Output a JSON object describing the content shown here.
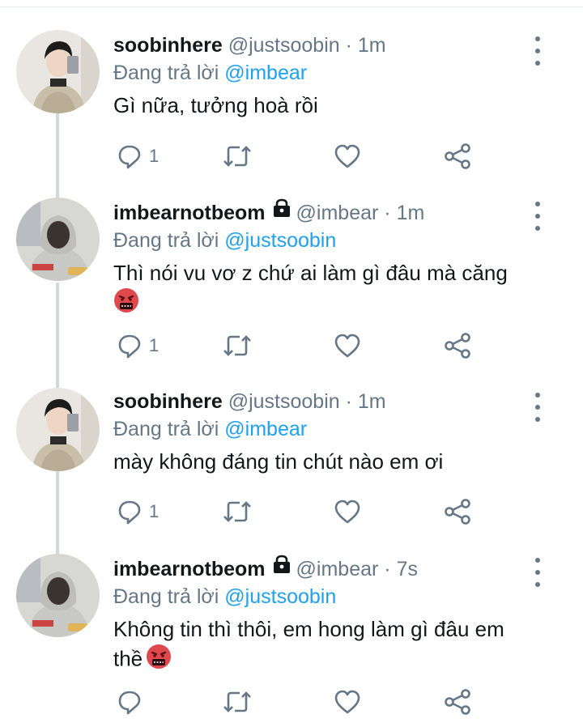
{
  "tweets": [
    {
      "display_name": "soobinhere",
      "handle": "@justsoobin",
      "time": "1m",
      "replying_prefix": "Đang trả lời",
      "replying_to": "@imbear",
      "text": "Gì nữa, tưởng hoà rồi",
      "reply_count": "1",
      "locked": false
    },
    {
      "display_name": "imbearnotbeom",
      "handle": "@imbear",
      "time": "1m",
      "replying_prefix": "Đang trả lời",
      "replying_to": "@justsoobin",
      "text": "Thì nói vu vơ z chứ ai làm gì đâu mà căng",
      "reply_count": "1",
      "locked": true
    },
    {
      "display_name": "soobinhere",
      "handle": "@justsoobin",
      "time": "1m",
      "replying_prefix": "Đang trả lời",
      "replying_to": "@imbear",
      "text": "mày không đáng tin chút nào em ơi",
      "reply_count": "1",
      "locked": false
    },
    {
      "display_name": "imbearnotbeom",
      "handle": "@imbear",
      "time": "7s",
      "replying_prefix": "Đang trả lời",
      "replying_to": "@justsoobin",
      "text": "Không tin thì thôi, em hong làm gì đâu em thề",
      "reply_count": "",
      "locked": true
    }
  ],
  "separator": "·",
  "icons": {
    "reply": "reply-icon",
    "retweet": "retweet-icon",
    "like": "like-icon",
    "share": "share-icon",
    "more": "more-vertical-icon",
    "lock": "lock-icon",
    "emoji": "cursing-face-emoji"
  },
  "colors": {
    "name": "#14171a",
    "secondary": "#657786",
    "mention": "#1da1f2",
    "thread_line": "#cfd9de"
  }
}
